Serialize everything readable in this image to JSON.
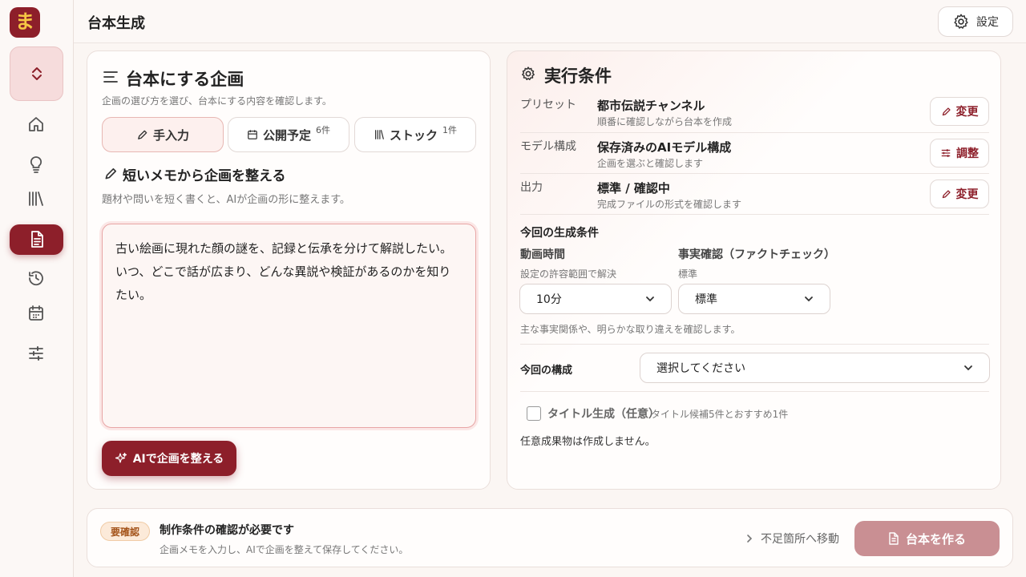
{
  "app": {
    "logo_char": "ま",
    "brand_color": "#8d1f2a"
  },
  "sidebar": {
    "items": [
      {
        "name": "home-icon"
      },
      {
        "name": "lightbulb-icon"
      },
      {
        "name": "library-icon"
      },
      {
        "name": "document-icon",
        "active": true
      },
      {
        "name": "history-icon"
      },
      {
        "name": "calendar-icon"
      },
      {
        "name": "sliders-icon"
      }
    ]
  },
  "header": {
    "title": "台本生成",
    "settings_label": "設定"
  },
  "planning": {
    "title": "台本にする企画",
    "subtitle": "企画の選び方を選び、台本にする内容を確認します。",
    "tabs": [
      {
        "label": "手入力",
        "count": ""
      },
      {
        "label": "公開予定",
        "count": "6件"
      },
      {
        "label": "ストック",
        "count": "1件"
      }
    ],
    "memo_title": "短いメモから企画を整える",
    "memo_hint": "題材や問いを短く書くと、AIが企画の形に整えます。",
    "memo_text_line1": "古い絵画に現れた顔の謎を、記録と伝承を分けて解説したい。",
    "memo_text_line2": "いつ、どこで話が広まり、どんな異説や検証があるのかを知り",
    "memo_text_line3": "たい。",
    "ai_button": "AIで企画を整える"
  },
  "conditions": {
    "title": "実行条件",
    "rows": [
      {
        "label": "プリセット",
        "value": "都市伝説チャンネル",
        "sub": "順番に確認しながら台本を作成",
        "button": "変更"
      },
      {
        "label": "モデル構成",
        "value": "保存済みのAIモデル構成",
        "sub": "企画を選ぶと確認します",
        "button": "調整"
      },
      {
        "label": "出力",
        "value": "標準 / 確認中",
        "sub": "完成ファイルの形式を確認します",
        "button": "変更"
      }
    ],
    "gen_title": "今回の生成条件",
    "duration_label": "動画時間",
    "duration_hint": "設定の許容範囲で解決",
    "duration_value": "10分",
    "factcheck_label": "事実確認（ファクトチェック）",
    "factcheck_hint": "標準",
    "factcheck_value": "標準",
    "factcheck_note": "主な事実関係や、明らかな取り違えを確認します。",
    "structure_label": "今回の構成",
    "structure_value": "選択してください",
    "title_gen_label": "タイトル生成（任意）",
    "title_gen_hint": "タイトル候補5件とおすすめ1件",
    "optional_note": "任意成果物は作成しません。"
  },
  "footer": {
    "badge": "要確認",
    "message": "制作条件の確認が必要です",
    "sub": "企画メモを入力し、AIで企画を整えて保存してください。",
    "jump_label": "不足箇所へ移動",
    "create_button": "台本を作る"
  }
}
